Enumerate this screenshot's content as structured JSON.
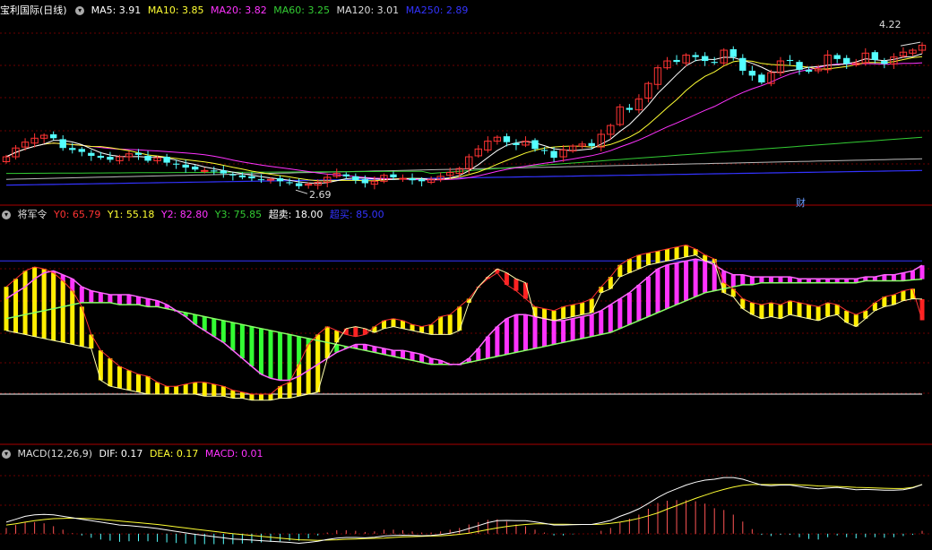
{
  "colors": {
    "bg": "#000000",
    "grid": "#6b0000",
    "up": "#ff3333",
    "down": "#54ffff",
    "ma5": "#ffffff",
    "ma10": "#ffff33",
    "ma20": "#ff33ff",
    "ma60": "#33cc33",
    "ma120": "#bbbbbb",
    "ma250": "#3333ff"
  },
  "price_header": {
    "title": "宝利国际(日线)",
    "ma5": "MA5: 3.91",
    "ma10": "MA10: 3.85",
    "ma20": "MA20: 3.82",
    "ma60": "MA60: 3.25",
    "ma120": "MA120: 3.01",
    "ma250": "MA250: 2.89"
  },
  "price_annotations": {
    "high": "4.22",
    "low": "2.69",
    "finance_marker": "财"
  },
  "indicator_header": {
    "title": "将军令",
    "y0": "Y0: 65.79",
    "y1": "Y1: 55.18",
    "y2": "Y2: 82.80",
    "y3": "Y3: 75.85",
    "oversold": "超卖: 18.00",
    "overbought": "超买: 85.00"
  },
  "macd_header": {
    "title": "MACD(12,26,9)",
    "dif": "DIF: 0.17",
    "dea": "DEA: 0.17",
    "macd": "MACD: 0.01"
  },
  "chart_data": [
    {
      "type": "candlestick",
      "title": "宝利国际(日线)",
      "ylim": [
        2.6,
        4.45
      ],
      "high_label": 4.22,
      "low_label": 2.69,
      "closes": [
        3.03,
        3.12,
        3.18,
        3.22,
        3.25,
        3.22,
        3.12,
        3.1,
        3.08,
        3.04,
        3.02,
        3.0,
        3.03,
        3.06,
        3.05,
        2.99,
        3.02,
        2.97,
        2.95,
        2.92,
        2.9,
        2.89,
        2.88,
        2.86,
        2.84,
        2.82,
        2.81,
        2.8,
        2.8,
        2.78,
        2.76,
        2.73,
        2.75,
        2.77,
        2.82,
        2.86,
        2.83,
        2.79,
        2.76,
        2.78,
        2.84,
        2.82,
        2.81,
        2.79,
        2.78,
        2.8,
        2.83,
        2.87,
        2.91,
        3.03,
        3.11,
        3.19,
        3.23,
        3.18,
        3.15,
        3.19,
        3.11,
        3.09,
        3.02,
        3.1,
        3.14,
        3.16,
        3.14,
        3.26,
        3.35,
        3.54,
        3.51,
        3.62,
        3.78,
        3.94,
        4.01,
        4.0,
        4.07,
        4.05,
        4.01,
        3.99,
        4.12,
        4.05,
        3.91,
        3.86,
        3.79,
        3.89,
        4.01,
        4.01,
        3.92,
        3.9,
        3.93,
        4.07,
        4.03,
        3.98,
        3.99,
        4.09,
        4.02,
        3.98,
        4.05,
        4.1,
        4.12,
        4.17
      ]
    },
    {
      "type": "line",
      "title": "将军令",
      "ylim": [
        0,
        100
      ],
      "oversold": 18.0,
      "overbought": 85.0,
      "series": [
        {
          "name": "Y0",
          "values": [
            50.0,
            49.0,
            48.0,
            47.0,
            46.0,
            45.0,
            44.0,
            43.0,
            42.0,
            41.0,
            25.0,
            22.0,
            21.0,
            20.0,
            19.0,
            18.0,
            18.0,
            18.0,
            18.0,
            18.0,
            18.0,
            17.0,
            17.0,
            17.0,
            16.0,
            16.0,
            15.0,
            15.0,
            15.0,
            16.0,
            16.0,
            17.0,
            18.0,
            19.0,
            36.0,
            44.0,
            51.0,
            52.0,
            51.0,
            49.0,
            51.0,
            52.0,
            51.0,
            50.0,
            49.0,
            48.0,
            48.0,
            48.0,
            50.0,
            64.0,
            72.0,
            77.0,
            81.0,
            79.0,
            76.0,
            74.0,
            57.0,
            56.0,
            55.0,
            56.0,
            57.0,
            58.0,
            59.0,
            69.0,
            71.0,
            77.0,
            79.0,
            81.0,
            83.0,
            84.0,
            85.0,
            86.0,
            87.0,
            88.0,
            85.0,
            84.0,
            69.0,
            67.0,
            61.0,
            58.0,
            56.0,
            57.0,
            56.0,
            58.0,
            57.0,
            56.0,
            55.0,
            57.0,
            58.0,
            54.0,
            52.0,
            56.0,
            60.0,
            62.0,
            63.0,
            65.0,
            66.0,
            65.79
          ]
        },
        {
          "name": "Y1",
          "values": [
            72.0,
            76.0,
            80.0,
            82.0,
            81.0,
            79.0,
            75.0,
            70.0,
            62.0,
            48.0,
            40.0,
            36.0,
            32.0,
            30.0,
            28.0,
            27.0,
            24.0,
            22.0,
            22.0,
            23.0,
            24.0,
            24.0,
            23.0,
            22.0,
            20.0,
            19.0,
            18.0,
            18.0,
            18.0,
            22.0,
            24.0,
            33.0,
            43.0,
            48.0,
            52.0,
            50.0,
            48.0,
            47.0,
            48.0,
            52.0,
            55.0,
            56.0,
            55.0,
            53.0,
            52.0,
            53.0,
            57.0,
            58.0,
            62.0,
            66.0,
            72.0,
            76.0,
            79.0,
            73.0,
            70.0,
            66.0,
            62.0,
            61.0,
            60.0,
            62.0,
            63.0,
            64.0,
            66.0,
            72.0,
            77.0,
            83.0,
            86.0,
            88.0,
            89.0,
            90.0,
            91.0,
            92.0,
            93.0,
            91.0,
            88.0,
            86.0,
            74.0,
            71.0,
            66.0,
            64.0,
            63.0,
            64.0,
            63.0,
            65.0,
            64.0,
            63.0,
            62.0,
            64.0,
            63.0,
            60.0,
            58.0,
            60.0,
            64.0,
            67.0,
            68.0,
            70.0,
            71.0,
            55.18
          ]
        },
        {
          "name": "Y2",
          "values": [
            66.0,
            69.0,
            72.0,
            76.0,
            79.0,
            80.0,
            78.0,
            76.0,
            72.0,
            70.0,
            69.0,
            68.0,
            68.0,
            68.0,
            67.0,
            66.0,
            65.0,
            63.0,
            60.0,
            57.0,
            53.0,
            50.0,
            47.0,
            44.0,
            40.0,
            36.0,
            32.0,
            28.0,
            26.0,
            25.0,
            25.0,
            27.0,
            30.0,
            33.0,
            36.0,
            39.0,
            41.0,
            43.0,
            43.0,
            42.0,
            41.0,
            40.0,
            40.0,
            39.0,
            38.0,
            36.0,
            35.0,
            33.0,
            33.0,
            36.0,
            41.0,
            47.0,
            52.0,
            56.0,
            58.0,
            58.0,
            57.0,
            56.0,
            55.0,
            55.0,
            56.0,
            57.0,
            58.0,
            60.0,
            63.0,
            66.0,
            69.0,
            73.0,
            77.0,
            81.0,
            83.0,
            84.0,
            85.0,
            86.0,
            85.0,
            83.0,
            80.0,
            78.0,
            78.0,
            77.0,
            77.0,
            77.0,
            77.0,
            77.0,
            76.0,
            76.0,
            76.0,
            76.0,
            76.0,
            76.0,
            76.0,
            77.0,
            77.0,
            78.0,
            78.0,
            79.0,
            80.0,
            82.8
          ]
        },
        {
          "name": "Y3",
          "values": [
            56.0,
            57.0,
            58.0,
            59.0,
            60.0,
            61.0,
            62.0,
            63.0,
            64.0,
            64.0,
            64.0,
            64.0,
            63.0,
            63.0,
            63.0,
            62.0,
            62.0,
            61.0,
            60.0,
            59.0,
            58.0,
            57.0,
            56.0,
            55.0,
            54.0,
            53.0,
            52.0,
            51.0,
            50.0,
            49.0,
            48.0,
            47.0,
            46.0,
            45.0,
            44.0,
            43.0,
            42.0,
            41.0,
            40.0,
            39.0,
            38.0,
            37.0,
            36.0,
            35.0,
            34.0,
            33.0,
            33.0,
            33.0,
            33.0,
            34.0,
            35.0,
            36.0,
            37.0,
            38.0,
            39.0,
            40.0,
            41.0,
            42.0,
            43.0,
            44.0,
            45.0,
            46.0,
            47.0,
            48.0,
            49.0,
            51.0,
            53.0,
            55.0,
            57.0,
            59.0,
            61.0,
            63.0,
            65.0,
            67.0,
            69.0,
            70.0,
            71.0,
            72.0,
            73.0,
            73.0,
            74.0,
            74.0,
            74.0,
            74.0,
            74.0,
            74.0,
            74.0,
            74.0,
            74.0,
            74.0,
            74.0,
            75.0,
            75.0,
            75.0,
            75.0,
            75.0,
            75.5,
            75.85
          ]
        }
      ]
    },
    {
      "type": "bar",
      "title": "MACD(12,26,9)",
      "ylim": [
        -0.05,
        0.25
      ],
      "series": [
        {
          "name": "DIF",
          "values": [
            0.04,
            0.05,
            0.06,
            0.065,
            0.067,
            0.065,
            0.06,
            0.055,
            0.05,
            0.045,
            0.04,
            0.035,
            0.03,
            0.028,
            0.025,
            0.022,
            0.018,
            0.013,
            0.008,
            0.003,
            -0.002,
            -0.006,
            -0.01,
            -0.014,
            -0.018,
            -0.02,
            -0.022,
            -0.024,
            -0.026,
            -0.028,
            -0.03,
            -0.033,
            -0.03,
            -0.026,
            -0.02,
            -0.015,
            -0.013,
            -0.013,
            -0.014,
            -0.012,
            -0.008,
            -0.006,
            -0.005,
            -0.006,
            -0.007,
            -0.006,
            -0.003,
            0.002,
            0.008,
            0.018,
            0.028,
            0.038,
            0.045,
            0.046,
            0.045,
            0.045,
            0.041,
            0.036,
            0.03,
            0.03,
            0.031,
            0.032,
            0.032,
            0.038,
            0.046,
            0.06,
            0.072,
            0.086,
            0.105,
            0.125,
            0.142,
            0.155,
            0.168,
            0.178,
            0.185,
            0.188,
            0.194,
            0.194,
            0.188,
            0.178,
            0.168,
            0.166,
            0.168,
            0.168,
            0.163,
            0.158,
            0.155,
            0.158,
            0.16,
            0.156,
            0.152,
            0.153,
            0.152,
            0.15,
            0.15,
            0.152,
            0.158,
            0.17
          ]
        },
        {
          "name": "DEA",
          "values": [
            0.03,
            0.034,
            0.04,
            0.045,
            0.049,
            0.052,
            0.053,
            0.054,
            0.053,
            0.052,
            0.05,
            0.047,
            0.044,
            0.041,
            0.038,
            0.035,
            0.032,
            0.028,
            0.024,
            0.02,
            0.016,
            0.012,
            0.008,
            0.004,
            0.0,
            -0.003,
            -0.006,
            -0.009,
            -0.012,
            -0.015,
            -0.018,
            -0.021,
            -0.022,
            -0.023,
            -0.022,
            -0.021,
            -0.019,
            -0.018,
            -0.017,
            -0.016,
            -0.015,
            -0.013,
            -0.011,
            -0.01,
            -0.009,
            -0.008,
            -0.007,
            -0.005,
            -0.002,
            0.002,
            0.008,
            0.014,
            0.02,
            0.025,
            0.029,
            0.032,
            0.034,
            0.034,
            0.033,
            0.033,
            0.032,
            0.032,
            0.032,
            0.033,
            0.036,
            0.04,
            0.046,
            0.053,
            0.062,
            0.072,
            0.085,
            0.097,
            0.11,
            0.122,
            0.133,
            0.144,
            0.153,
            0.161,
            0.167,
            0.17,
            0.17,
            0.17,
            0.17,
            0.17,
            0.169,
            0.167,
            0.165,
            0.164,
            0.163,
            0.162,
            0.16,
            0.159,
            0.158,
            0.157,
            0.156,
            0.156,
            0.16,
            0.17
          ]
        },
        {
          "name": "MACD",
          "values": [
            0.02,
            0.03,
            0.04,
            0.04,
            0.036,
            0.026,
            0.014,
            0.002,
            -0.006,
            -0.014,
            -0.02,
            -0.024,
            -0.028,
            -0.026,
            -0.026,
            -0.026,
            -0.028,
            -0.03,
            -0.032,
            -0.034,
            -0.036,
            -0.036,
            -0.036,
            -0.036,
            -0.036,
            -0.034,
            -0.032,
            -0.03,
            -0.028,
            -0.026,
            -0.024,
            -0.024,
            -0.016,
            -0.006,
            0.004,
            0.012,
            0.012,
            0.01,
            0.006,
            0.008,
            0.014,
            0.014,
            0.012,
            0.008,
            0.004,
            0.004,
            0.008,
            0.014,
            0.02,
            0.032,
            0.04,
            0.048,
            0.05,
            0.042,
            0.032,
            0.026,
            0.014,
            0.004,
            -0.006,
            -0.006,
            -0.002,
            0.0,
            0.0,
            0.01,
            0.02,
            0.04,
            0.052,
            0.066,
            0.086,
            0.106,
            0.114,
            0.116,
            0.116,
            0.112,
            0.104,
            0.088,
            0.082,
            0.066,
            0.042,
            0.016,
            -0.004,
            -0.008,
            -0.004,
            -0.004,
            -0.012,
            -0.018,
            -0.02,
            -0.012,
            -0.006,
            -0.012,
            -0.016,
            -0.012,
            -0.012,
            -0.014,
            -0.012,
            -0.008,
            -0.004,
            0.01
          ]
        }
      ]
    }
  ]
}
